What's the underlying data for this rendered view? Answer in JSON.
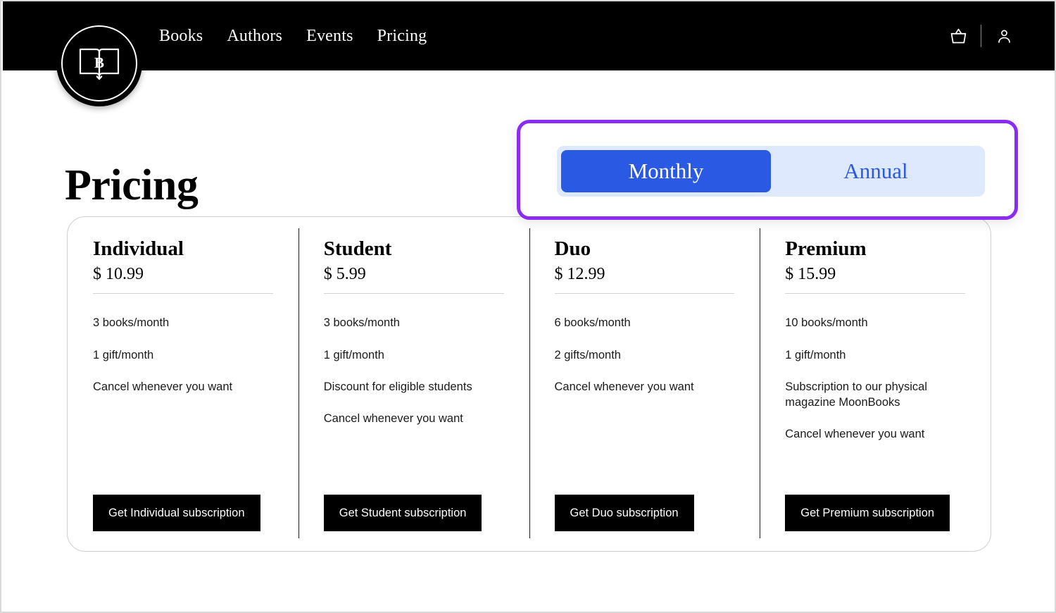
{
  "header": {
    "logo_letter": "B",
    "logo_name": "book-logo",
    "nav": [
      {
        "label": "Books"
      },
      {
        "label": "Authors"
      },
      {
        "label": "Events"
      },
      {
        "label": "Pricing"
      }
    ],
    "icons": [
      {
        "name": "basket-icon"
      },
      {
        "name": "account-icon"
      }
    ]
  },
  "page": {
    "title": "Pricing"
  },
  "billing_toggle": {
    "highlighted": true,
    "highlight_color": "#8B2BF5",
    "active_color": "#2A59E3",
    "track_color": "#DEE9FD",
    "selected": "Monthly",
    "options": [
      {
        "label": "Monthly",
        "state": "active"
      },
      {
        "label": "Annual",
        "state": "inactive"
      }
    ]
  },
  "plans": [
    {
      "name": "Individual",
      "price": "$ 10.99",
      "features": [
        "3 books/month",
        "1 gift/month",
        "Cancel whenever you want"
      ],
      "cta": "Get Individual subscription"
    },
    {
      "name": "Student",
      "price": "$ 5.99",
      "features": [
        "3 books/month",
        "1 gift/month",
        "Discount for eligible students",
        "Cancel whenever you want"
      ],
      "cta": "Get Student subscription"
    },
    {
      "name": "Duo",
      "price": "$ 12.99",
      "features": [
        "6 books/month",
        "2 gifts/month",
        "Cancel whenever you want"
      ],
      "cta": "Get Duo subscription"
    },
    {
      "name": "Premium",
      "price": "$ 15.99",
      "features": [
        "10 books/month",
        "1 gift/month",
        "Subscription to our physical magazine MoonBooks",
        "Cancel whenever you want"
      ],
      "cta": "Get Premium subscription"
    }
  ]
}
